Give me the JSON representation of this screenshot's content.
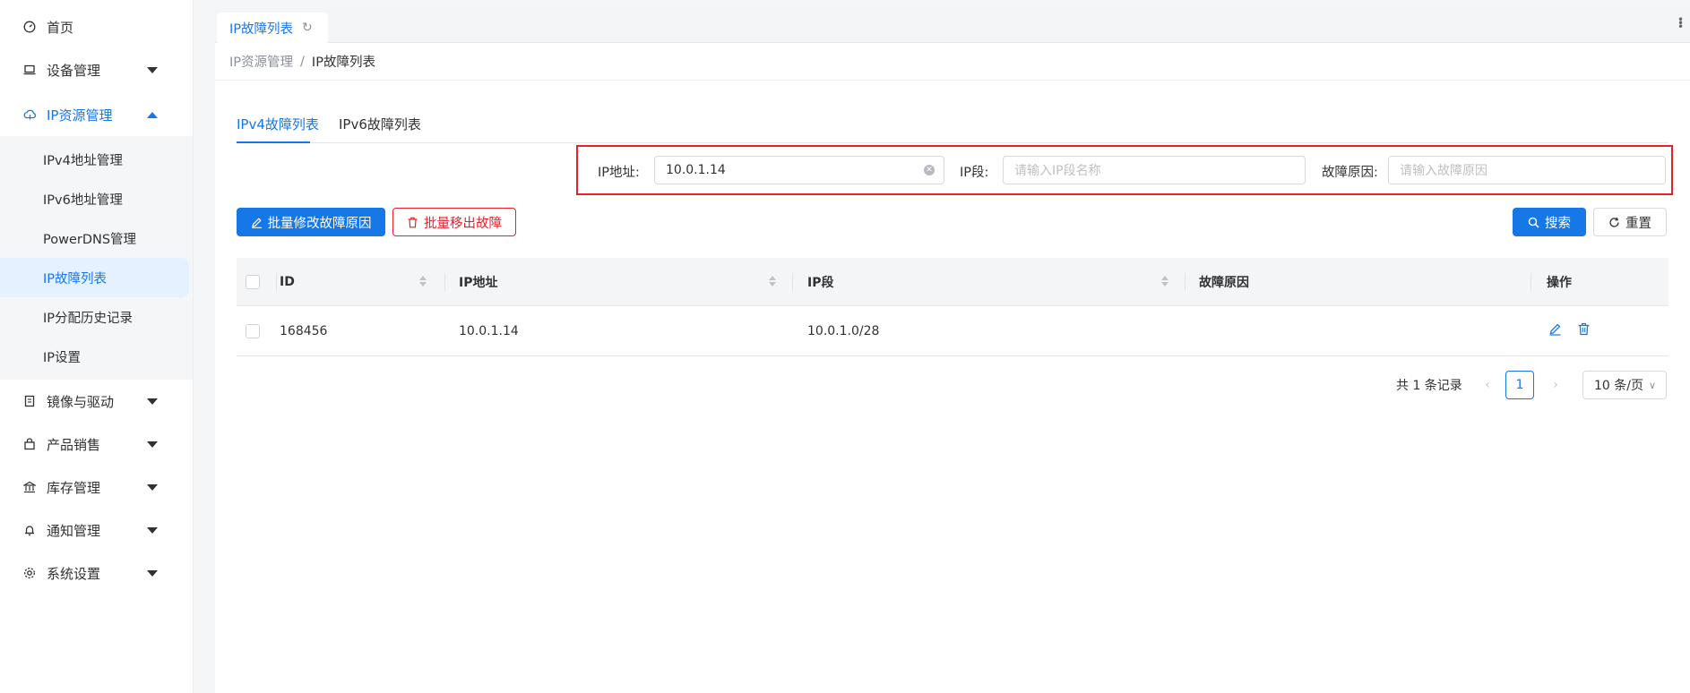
{
  "sidebar": {
    "home": "首页",
    "device": "设备管理",
    "ip_resource": "IP资源管理",
    "sub": {
      "ipv4": "IPv4地址管理",
      "ipv6": "IPv6地址管理",
      "powerdns": "PowerDNS管理",
      "ip_fault": "IP故障列表",
      "ip_history": "IP分配历史记录",
      "ip_settings": "IP设置"
    },
    "image": "镜像与驱动",
    "product": "产品销售",
    "inventory": "库存管理",
    "notice": "通知管理",
    "system": "系统设置"
  },
  "tabbar": {
    "active_tab": "IP故障列表"
  },
  "breadcrumb": {
    "parent": "IP资源管理",
    "sep": "/",
    "current": "IP故障列表"
  },
  "tabs": {
    "ipv4": "IPv4故障列表",
    "ipv6": "IPv6故障列表"
  },
  "filter": {
    "ip_label": "IP地址:",
    "ip_value": "10.0.1.14",
    "segment_label": "IP段:",
    "segment_placeholder": "请输入IP段名称",
    "reason_label": "故障原因:",
    "reason_placeholder": "请输入故障原因"
  },
  "actions": {
    "batch_edit": "批量修改故障原因",
    "batch_remove": "批量移出故障",
    "search": "搜索",
    "reset": "重置"
  },
  "table": {
    "headers": {
      "id": "ID",
      "ip": "IP地址",
      "segment": "IP段",
      "reason": "故障原因",
      "ops": "操作"
    },
    "rows": [
      {
        "id": "168456",
        "ip": "10.0.1.14",
        "segment": "10.0.1.0/28",
        "reason": ""
      }
    ]
  },
  "pagination": {
    "total": "共 1 条记录",
    "current_page": "1",
    "page_size": "10 条/页"
  },
  "colors": {
    "primary": "#1677e6",
    "danger": "#e5222c",
    "highlight_box": "#e5222c"
  }
}
